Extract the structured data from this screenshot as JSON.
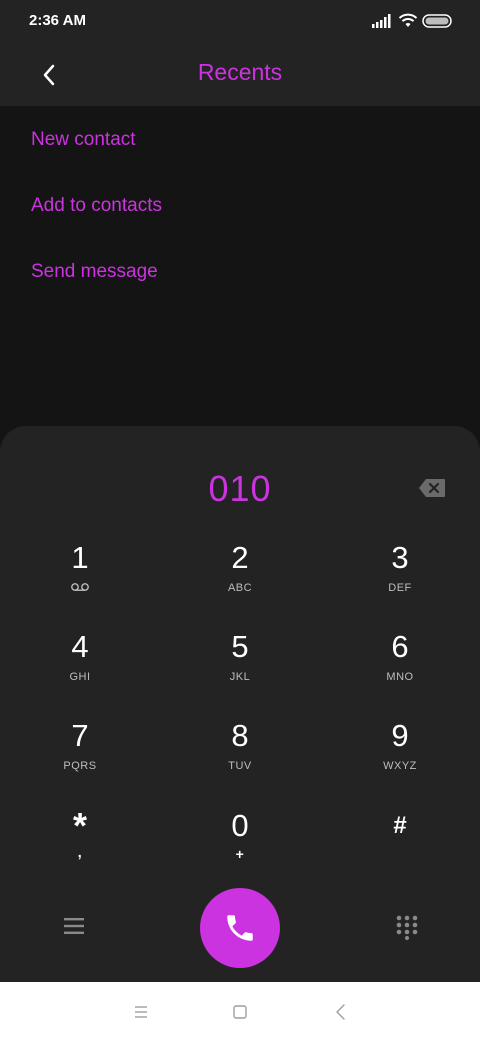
{
  "status": {
    "time": "2:36 AM"
  },
  "header": {
    "title": "Recents"
  },
  "actions": {
    "new_contact": "New contact",
    "add_to_contacts": "Add to contacts",
    "send_message": "Send message"
  },
  "dialer": {
    "number": "010",
    "keys": [
      {
        "digit": "1",
        "letters": ""
      },
      {
        "digit": "2",
        "letters": "ABC"
      },
      {
        "digit": "3",
        "letters": "DEF"
      },
      {
        "digit": "4",
        "letters": "GHI"
      },
      {
        "digit": "5",
        "letters": "JKL"
      },
      {
        "digit": "6",
        "letters": "MNO"
      },
      {
        "digit": "7",
        "letters": "PQRS"
      },
      {
        "digit": "8",
        "letters": "TUV"
      },
      {
        "digit": "9",
        "letters": "WXYZ"
      },
      {
        "digit": "*",
        "letters": ","
      },
      {
        "digit": "0",
        "letters": "+"
      },
      {
        "digit": "#",
        "letters": ""
      }
    ]
  },
  "icons": {
    "back": "chevron-left-icon",
    "backspace": "backspace-icon",
    "voicemail": "voicemail-icon",
    "menu": "menu-icon",
    "call": "phone-icon",
    "dialpad": "dialpad-icon",
    "signal": "signal-icon",
    "wifi": "wifi-icon",
    "battery": "battery-icon"
  },
  "colors": {
    "accent": "#cc33e0",
    "background": "#141414",
    "surface": "#232323",
    "navbar": "#ffffff"
  }
}
